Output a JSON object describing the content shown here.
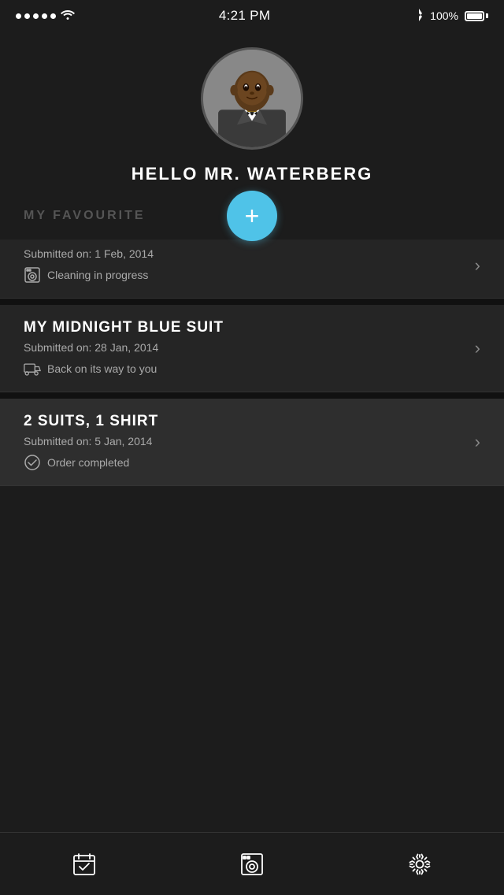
{
  "status_bar": {
    "time": "4:21 PM",
    "battery_pct": "100%"
  },
  "profile": {
    "greeting": "HELLO MR. WATERBERG"
  },
  "fab": {
    "label": "+"
  },
  "section_label": "MY FAVOURITE",
  "orders": [
    {
      "title": "",
      "date": "Submitted on: 1 Feb, 2014",
      "status": "Cleaning in progress",
      "status_icon": "washer"
    },
    {
      "title": "MY MIDNIGHT BLUE SUIT",
      "date": "Submitted on: 28 Jan, 2014",
      "status": "Back on its way to you",
      "status_icon": "truck"
    },
    {
      "title": "2 SUITS, 1 SHIRT",
      "date": "Submitted on: 5 Jan, 2014",
      "status": "Order completed",
      "status_icon": "check"
    }
  ],
  "nav": {
    "items": [
      {
        "label": "orders",
        "icon": "calendar-check"
      },
      {
        "label": "laundry",
        "icon": "washer"
      },
      {
        "label": "settings",
        "icon": "gear"
      }
    ]
  }
}
